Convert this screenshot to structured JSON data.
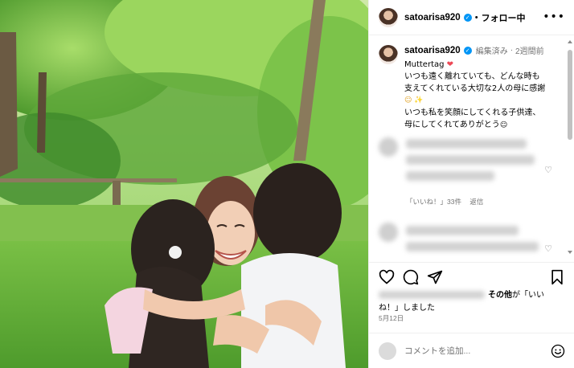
{
  "post": {
    "photo_description": "Photo of a smiling woman hugging two young children in a sunny green park",
    "username": "satoarisa920",
    "follow_label": "フォロー中",
    "caption": {
      "username": "satoarisa920",
      "edited": "編集済み",
      "time": "2週間前",
      "line1": "Muttertag",
      "line1_emoji": "❤",
      "line2": "いつも遠く離れていても、どんな時も",
      "line3": "支えてくれている大切な2人の母に感謝",
      "line3_emoji": "☺ ✨",
      "line4": "いつも私を笑顔にしてくれる子供達、",
      "line5": "母にしてくれてありがとう",
      "line5_emoji": "☺"
    },
    "comment_meta": {
      "likes_label": "「いいね！」33件",
      "reply_label": "返信"
    },
    "likes_text_others": "その他",
    "likes_text_suffix": "が「いいね！」しました",
    "likes_text_line2": "ね！」しました",
    "date": "5月12日",
    "add_comment_placeholder": "コメントを追加..."
  },
  "icons": {
    "heart": "heart-icon",
    "comment": "comment-icon",
    "share": "share-icon",
    "bookmark": "bookmark-icon",
    "emoji": "smile-icon",
    "more": "more-icon",
    "verified": "verified-badge-icon"
  },
  "colors": {
    "verified": "#0095f6",
    "secondary_text": "#737373",
    "divider": "#efefef",
    "heart": "#ed4956"
  }
}
